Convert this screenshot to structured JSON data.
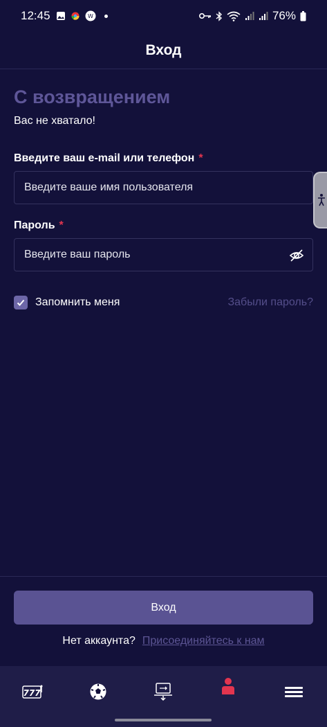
{
  "status_bar": {
    "time": "12:45",
    "battery": "76%"
  },
  "header": {
    "title": "Вход"
  },
  "welcome": {
    "title": "С возвращением",
    "subtitle": "Вас не хватало!"
  },
  "form": {
    "email_label": "Введите ваш e-mail или телефон",
    "email_placeholder": "Введите ваше имя пользователя",
    "password_label": "Пароль",
    "password_placeholder": "Введите ваш пароль",
    "required_mark": "*",
    "remember_label": "Запомнить меня",
    "remember_checked": true,
    "forgot_link": "Забыли пароль?"
  },
  "actions": {
    "login_button": "Вход",
    "no_account_text": "Нет аккаунта?",
    "join_link": "Присоединяйтесь к нам"
  },
  "bottom_nav": {
    "items": [
      {
        "icon": "slots-777-icon"
      },
      {
        "icon": "soccer-ball-icon"
      },
      {
        "icon": "transfer-icon"
      },
      {
        "icon": "profile-icon",
        "active": true,
        "active_color": "#e2354f"
      },
      {
        "icon": "menu-icon"
      }
    ]
  },
  "colors": {
    "background": "#13113a",
    "accent": "#5a5393",
    "required": "#e2354f",
    "title": "#5e5698"
  }
}
